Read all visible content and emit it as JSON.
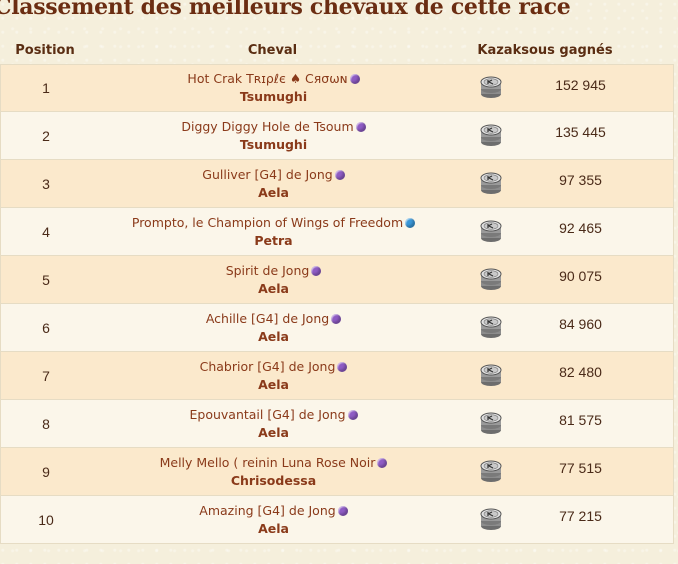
{
  "page": {
    "title": "Classement des meilleurs chevaux de cette race"
  },
  "table": {
    "headers": {
      "position": "Position",
      "horse": "Cheval",
      "kazaksous": "Kazaksous gagnés"
    },
    "rows": [
      {
        "position": "1",
        "horse": "Hot Crak Tʀɪρℓє ♠ Cяσωɴ",
        "owner": "Tsumughi",
        "gem": "purple-gem-icon",
        "kazaksous": "152 945"
      },
      {
        "position": "2",
        "horse": "Diggy Diggy Hole de Tsoum",
        "owner": "Tsumughi",
        "gem": "purple-gem-icon",
        "kazaksous": "135 445"
      },
      {
        "position": "3",
        "horse": "Gulliver [G4] de Jong",
        "owner": "Aela",
        "gem": "purple-gem-icon",
        "kazaksous": "97 355"
      },
      {
        "position": "4",
        "horse": "Prompto, le Champion of Wings of Freedom",
        "owner": "Petra",
        "gem": "blue-gem-icon",
        "kazaksous": "92 465"
      },
      {
        "position": "5",
        "horse": "Spirit de Jong",
        "owner": "Aela",
        "gem": "purple-gem-icon",
        "kazaksous": "90 075"
      },
      {
        "position": "6",
        "horse": "Achille [G4] de Jong",
        "owner": "Aela",
        "gem": "purple-gem-icon",
        "kazaksous": "84 960"
      },
      {
        "position": "7",
        "horse": "Chabrior [G4] de Jong",
        "owner": "Aela",
        "gem": "purple-gem-icon",
        "kazaksous": "82 480"
      },
      {
        "position": "8",
        "horse": "Epouvantail [G4] de Jong",
        "owner": "Aela",
        "gem": "purple-gem-icon",
        "kazaksous": "81 575"
      },
      {
        "position": "9",
        "horse": "Melly Mello ( reinin Luna Rose Noir",
        "owner": "Chrisodessa",
        "gem": "purple-gem-icon",
        "kazaksous": "77 515"
      },
      {
        "position": "10",
        "horse": "Amazing [G4] de Jong",
        "owner": "Aela",
        "gem": "purple-gem-icon",
        "kazaksous": "77 215"
      }
    ]
  },
  "colors": {
    "row_odd": "#fbe9cc",
    "row_even": "#fbf6ea",
    "text": "#8a3a1a",
    "title": "#6b2d12",
    "gem_purple": "#8e5bc4",
    "gem_blue": "#3a97d8"
  },
  "icons": {
    "coin": "kazaksous-coin-icon"
  }
}
